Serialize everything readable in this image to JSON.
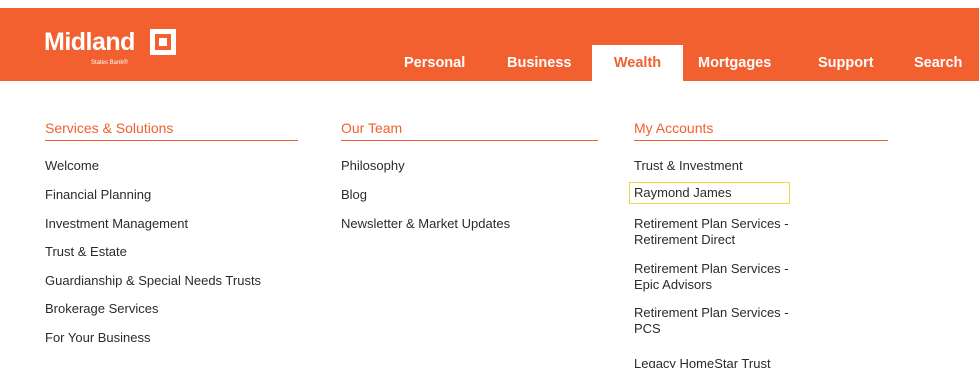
{
  "brand": {
    "name": "Midland",
    "subtitle": "States Bank®"
  },
  "nav": {
    "items": [
      {
        "label": "Personal"
      },
      {
        "label": "Business"
      },
      {
        "label": "Wealth",
        "active": true
      },
      {
        "label": "Mortgages"
      },
      {
        "label": "Support"
      },
      {
        "label": "Search"
      }
    ]
  },
  "menu": {
    "columns": [
      {
        "heading": "Services & Solutions",
        "links": [
          "Welcome",
          "Financial Planning",
          "Investment Management",
          "Trust & Estate",
          "Guardianship & Special Needs Trusts",
          "Brokerage Services",
          "For Your Business"
        ]
      },
      {
        "heading": "Our Team",
        "links": [
          "Philosophy",
          "Blog",
          "Newsletter & Market Updates"
        ]
      },
      {
        "heading": "My Accounts",
        "links": [
          "Trust & Investment",
          "Raymond James",
          "Retirement Plan Services - Retirement Direct",
          "Retirement Plan Services - Epic Advisors",
          "Retirement Plan Services - PCS",
          "Legacy HomeStar Trust"
        ]
      }
    ]
  },
  "colors": {
    "brand_orange": "#f2602f",
    "highlight_yellow": "#f5d742",
    "text": "#2b2b2b"
  }
}
